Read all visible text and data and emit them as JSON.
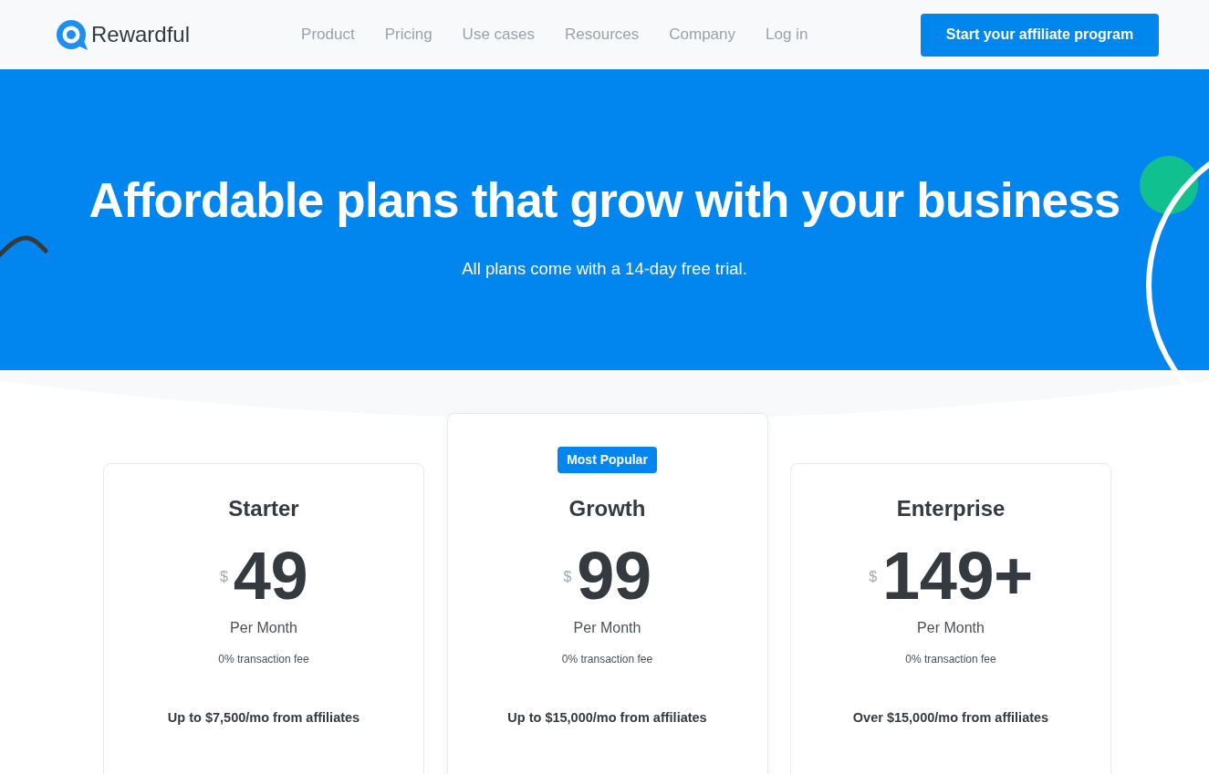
{
  "header": {
    "logo": "Rewardful",
    "nav": [
      "Product",
      "Pricing",
      "Use cases",
      "Resources",
      "Company",
      "Log in"
    ],
    "cta": "Start your affiliate program"
  },
  "hero": {
    "title": "Affordable plans that grow with your business",
    "subtitle": "All plans come with a 14-day free trial."
  },
  "plans": [
    {
      "name": "Starter",
      "featured": false,
      "currency": "$",
      "price": "49",
      "period": "Per Month",
      "fee": "0% transaction fee",
      "limit": "Up to $7,500/mo from affiliates"
    },
    {
      "name": "Growth",
      "featured": true,
      "badge": "Most Popular",
      "currency": "$",
      "price": "99",
      "period": "Per Month",
      "fee": "0% transaction fee",
      "limit": "Up to $15,000/mo from affiliates"
    },
    {
      "name": "Enterprise",
      "featured": false,
      "currency": "$",
      "price": "149+",
      "period": "Per Month",
      "fee": "0% transaction fee",
      "limit": "Over $15,000/mo from affiliates"
    }
  ]
}
